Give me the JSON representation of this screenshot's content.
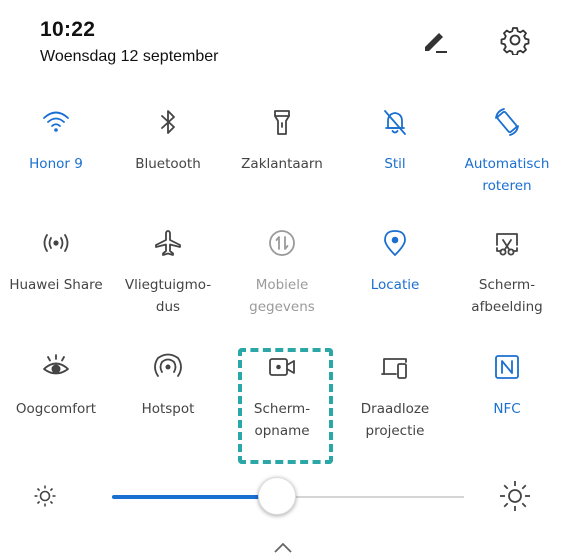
{
  "status": {
    "time": "10:22",
    "date": "Woensdag 12 september"
  },
  "colors": {
    "accent": "#1a6fd1",
    "icon": "#444444",
    "disabled": "#9a9a9a",
    "highlight": "#2aa7a6"
  },
  "header": {
    "edit_icon": "edit-pencil-icon",
    "settings_icon": "gear-icon"
  },
  "tiles": [
    {
      "label": "Honor 9",
      "icon": "wifi-icon",
      "state": "on"
    },
    {
      "label": "Bluetooth",
      "icon": "bluetooth-icon",
      "state": "neutral"
    },
    {
      "label": "Zaklantaarn",
      "icon": "flashlight-icon",
      "state": "neutral"
    },
    {
      "label": "Stil",
      "icon": "bell-off-icon",
      "state": "on"
    },
    {
      "label": "Automatisch\nroteren",
      "icon": "auto-rotate-icon",
      "state": "on"
    },
    {
      "label": "Huawei Share",
      "icon": "huawei-share-icon",
      "state": "neutral"
    },
    {
      "label": "Vliegtuigmo-\ndus",
      "icon": "airplane-icon",
      "state": "neutral"
    },
    {
      "label": "Mobiele\ngegevens",
      "icon": "mobile-data-icon",
      "state": "off"
    },
    {
      "label": "Locatie",
      "icon": "location-icon",
      "state": "on"
    },
    {
      "label": "Scherm-\nafbeelding",
      "icon": "screenshot-icon",
      "state": "neutral"
    },
    {
      "label": "Oogcomfort",
      "icon": "eye-icon",
      "state": "neutral"
    },
    {
      "label": "Hotspot",
      "icon": "hotspot-icon",
      "state": "neutral"
    },
    {
      "label": "Scherm-\nopname",
      "icon": "screen-record-icon",
      "state": "neutral"
    },
    {
      "label": "Draadloze\nprojectie",
      "icon": "wireless-projection-icon",
      "state": "neutral"
    },
    {
      "label": "NFC",
      "icon": "nfc-icon",
      "state": "on"
    }
  ],
  "brightness": {
    "level": 0.47
  }
}
